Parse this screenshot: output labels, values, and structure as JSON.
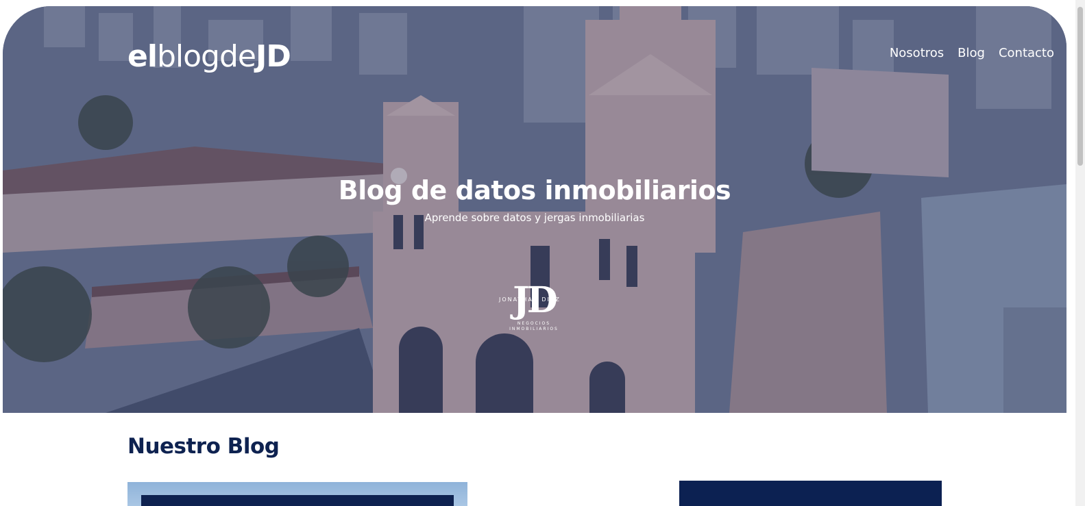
{
  "header": {
    "logo_part1": "el",
    "logo_part2": "blogde",
    "logo_part3": "JD",
    "nav": [
      {
        "label": "Nosotros"
      },
      {
        "label": "Blog"
      },
      {
        "label": "Contacto"
      }
    ]
  },
  "hero": {
    "title": "Blog de datos inmobiliarios",
    "subtitle": "Aprende sobre datos y jergas inmobiliarias",
    "brand_initials": "JD",
    "brand_name": "JONATHAN DIAZ",
    "brand_tag_line1": "NEGOCIOS",
    "brand_tag_line2": "INMOBILIARIOS"
  },
  "blog": {
    "section_title": "Nuestro Blog"
  },
  "colors": {
    "primary": "#0e2250",
    "hero_overlay": "#2e345c"
  }
}
